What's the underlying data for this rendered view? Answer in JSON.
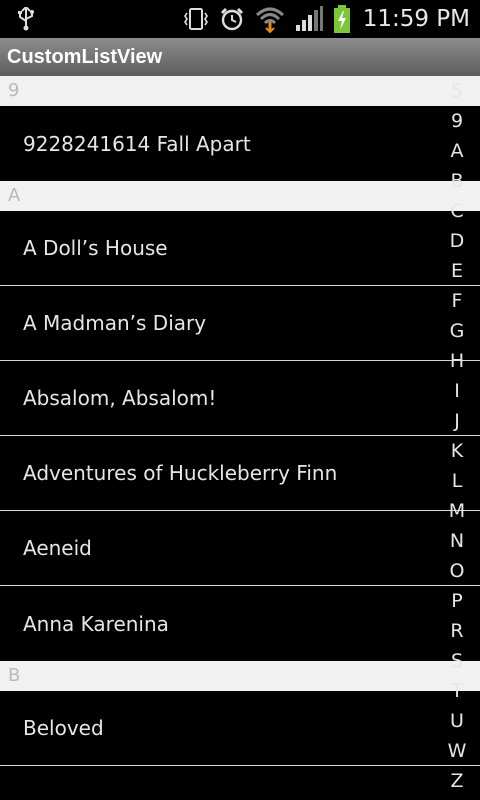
{
  "status_bar": {
    "time": "11:59 PM",
    "icons": [
      "usb-icon",
      "vibrate-icon",
      "alarm-icon",
      "wifi-icon",
      "signal-icon",
      "battery-charging-icon"
    ]
  },
  "app": {
    "title": "CustomListView"
  },
  "list": {
    "sections": [
      {
        "header": "9",
        "items": [
          "9228241614 Fall Apart"
        ]
      },
      {
        "header": "A",
        "items": [
          "A Doll’s House",
          "A Madman’s Diary",
          "Absalom, Absalom!",
          "Adventures of Huckleberry Finn",
          "Aeneid",
          "Anna Karenina"
        ]
      },
      {
        "header": "B",
        "items": [
          "Beloved"
        ]
      }
    ]
  },
  "index": {
    "letters": [
      "5",
      "9",
      "A",
      "B",
      "C",
      "D",
      "E",
      "F",
      "G",
      "H",
      "I",
      "J",
      "K",
      "L",
      "M",
      "N",
      "O",
      "P",
      "R",
      "S",
      "T",
      "U",
      "W",
      "Z"
    ]
  },
  "colors": {
    "background": "#000000",
    "section_header_bg": "#f1f1f1",
    "section_header_text": "#b9b9b9",
    "item_text": "#e6e6e6",
    "title_bar": "#7a7a7a"
  }
}
